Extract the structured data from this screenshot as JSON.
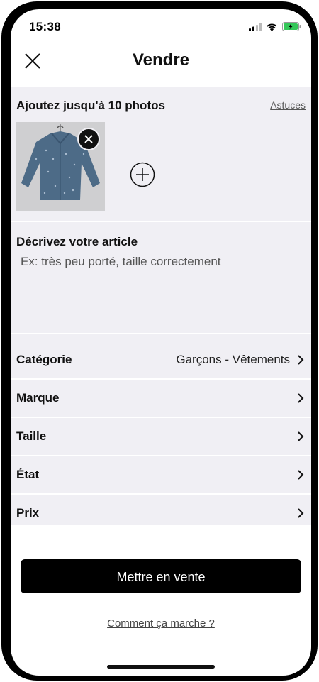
{
  "status_bar": {
    "time": "15:38"
  },
  "header": {
    "title": "Vendre"
  },
  "photos": {
    "title": "Ajoutez jusqu'à 10 photos",
    "tips_label": "Astuces"
  },
  "description": {
    "title": "Décrivez votre article",
    "placeholder": "Ex: très peu porté, taille correctement"
  },
  "rows": [
    {
      "label": "Catégorie",
      "value": "Garçons - Vêtements"
    },
    {
      "label": "Marque",
      "value": ""
    },
    {
      "label": "Taille",
      "value": ""
    },
    {
      "label": "État",
      "value": ""
    },
    {
      "label": "Prix",
      "value": ""
    }
  ],
  "cta_label": "Mettre en vente",
  "help_link": "Comment ça marche ?",
  "icons": [
    "close-icon",
    "remove-photo-icon",
    "add-photo-icon",
    "chevron-right-icon",
    "signal-icon",
    "wifi-icon",
    "battery-icon"
  ],
  "colors": {
    "background": "#f0eff4",
    "primary": "#000000",
    "battery_green": "#34c759"
  }
}
